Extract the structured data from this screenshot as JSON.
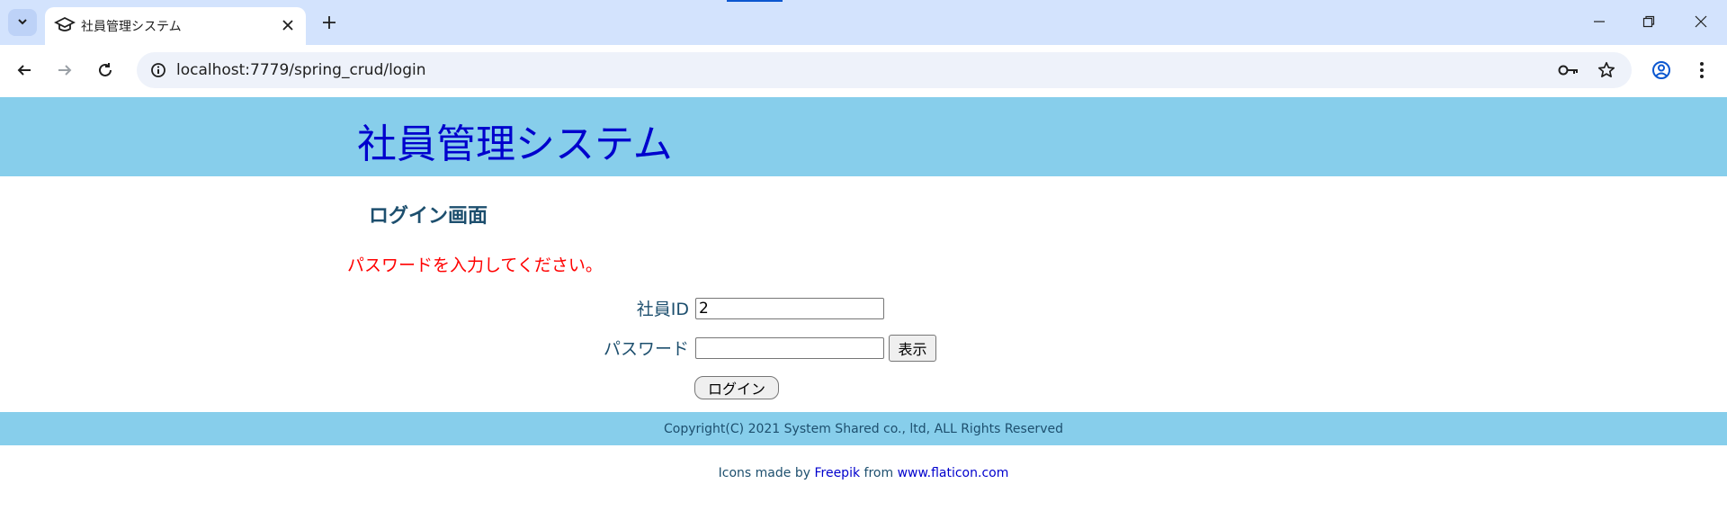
{
  "browser": {
    "tab_title": "社員管理システム",
    "url": "localhost:7779/spring_crud/login"
  },
  "header": {
    "title": "社員管理システム"
  },
  "login": {
    "heading": "ログイン画面",
    "error": "パスワードを入力してください。",
    "employee_id_label": "社員ID",
    "employee_id_value": "2",
    "password_label": "パスワード",
    "password_value": "",
    "show_button": "表示",
    "login_button": "ログイン"
  },
  "footer": {
    "copyright": "Copyright(C) 2021 System Shared co., ltd, ALL Rights Reserved",
    "credits_prefix": "Icons made by",
    "credits_author": "Freepik",
    "credits_middle": "from",
    "credits_site": "www.flaticon.com"
  },
  "colors": {
    "header_bg": "#87ceeb",
    "title_text": "#0000cd",
    "error_text": "#ff0000"
  }
}
